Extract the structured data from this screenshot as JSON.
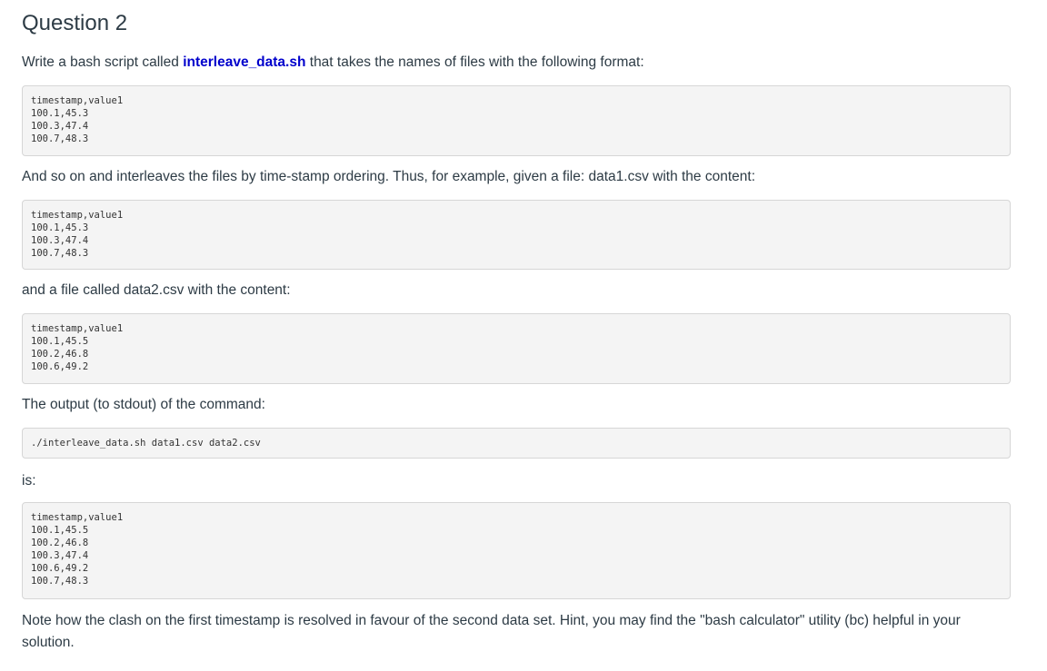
{
  "question_title": "Question 2",
  "intro": {
    "before": "Write a bash script called ",
    "script_name": "interleave_data.sh",
    "after": " that takes the names of files with the following format:"
  },
  "format_example": "timestamp,value1\n100.1,45.3\n100.3,47.4\n100.7,48.3",
  "para_and_so_on": "And so on and interleaves the files by time-stamp ordering. Thus, for example, given a file: data1.csv with the content:",
  "data1_content": "timestamp,value1\n100.1,45.3\n100.3,47.4\n100.7,48.3",
  "para_data2": "and a file called data2.csv with the content:",
  "data2_content": "timestamp,value1\n100.1,45.5\n100.2,46.8\n100.6,49.2",
  "para_output": "The output (to stdout)  of the command:",
  "command": "./interleave_data.sh data1.csv data2.csv",
  "para_is": "is:",
  "output_content": "timestamp,value1\n100.1,45.5\n100.2,46.8\n100.3,47.4\n100.6,49.2\n100.7,48.3",
  "note": "Note how the clash on the first timestamp is resolved in favour of the second data set. Hint, you may find the \"bash calculator\" utility (bc) helpful in your solution."
}
